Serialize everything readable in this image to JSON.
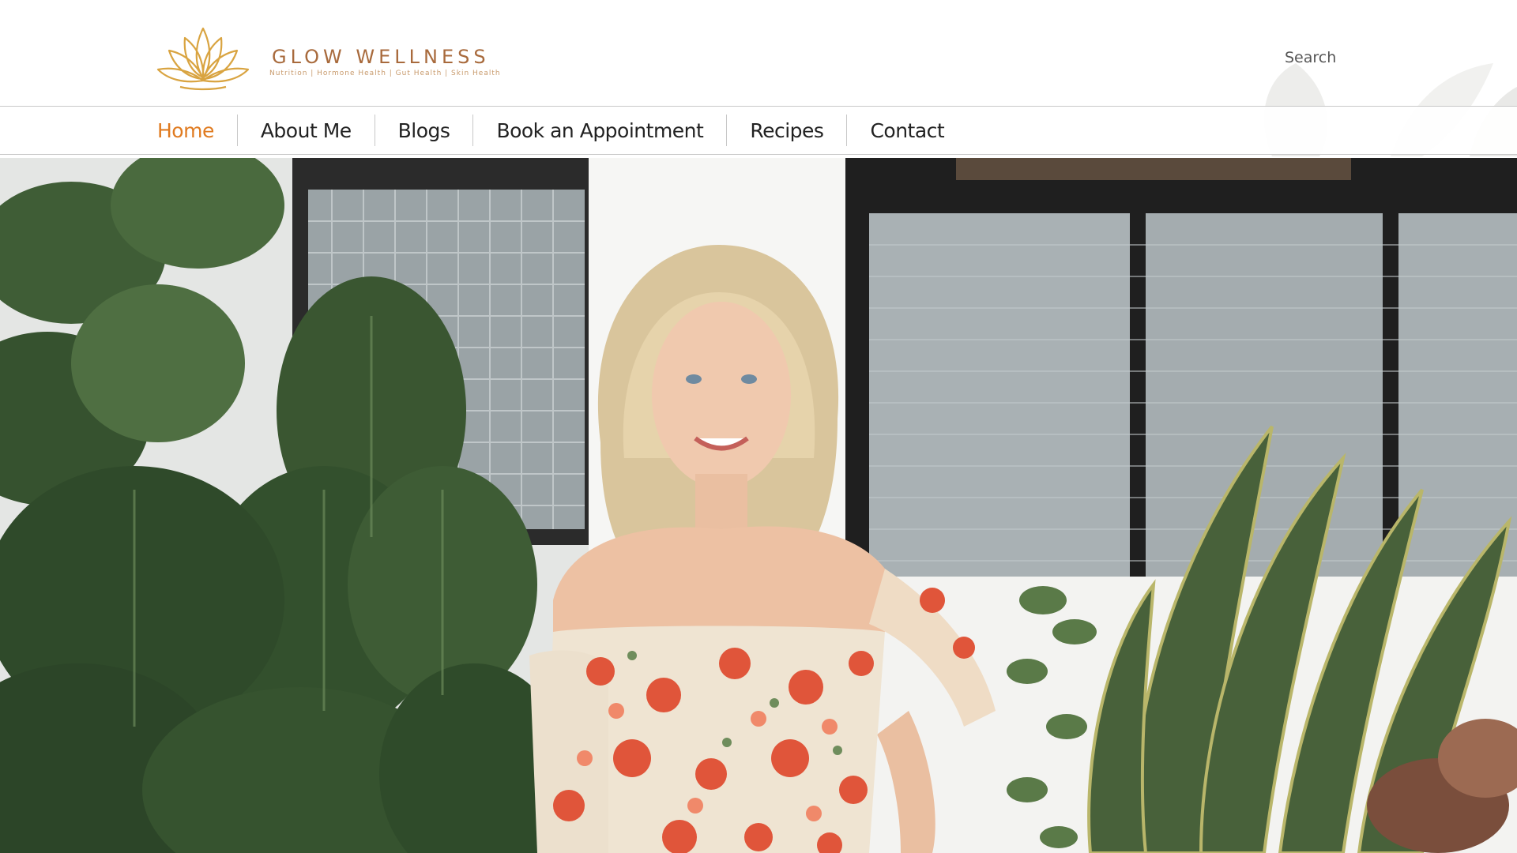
{
  "brand": {
    "name": "GLOW WELLNESS",
    "tagline": "Nutrition | Hormone Health | Gut Health | Skin Health",
    "accent_color": "#e07b20",
    "gold_color": "#d9a441"
  },
  "header": {
    "search_label": "Search"
  },
  "nav": {
    "items": [
      {
        "label": "Home",
        "active": true
      },
      {
        "label": "About Me",
        "active": false
      },
      {
        "label": "Blogs",
        "active": false
      },
      {
        "label": "Book an Appointment",
        "active": false
      },
      {
        "label": "Recipes",
        "active": false
      },
      {
        "label": "Contact",
        "active": false
      }
    ]
  },
  "hero": {
    "image_icon": "hero-photo",
    "colors": {
      "plants": "#3d5a33",
      "wall": "#f4f4f2",
      "dress": "#efe4d2",
      "flowers": "#e0553a"
    }
  }
}
